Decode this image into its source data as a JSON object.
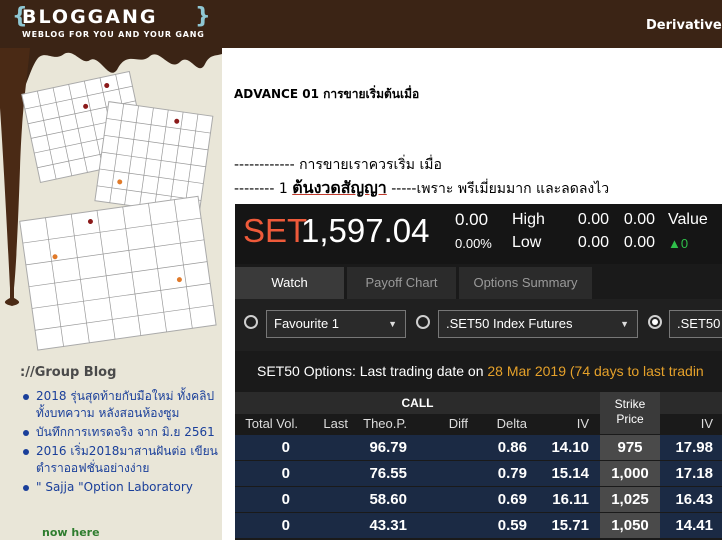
{
  "header": {
    "logo_text": "BLOGGANG",
    "logo_tagline": "WEBLOG FOR YOU AND YOUR GANG",
    "right_title": "Derivatives"
  },
  "sidebar": {
    "group_title": "://Group Blog",
    "items": [
      {
        "label": "2018 รุ่นสุดท้ายกับมือใหม่ ทั้งคลิป ทั้งบทความ หลังสอนห้องซูม"
      },
      {
        "label": "บันทึกการเทรดจริง จาก มิ.ย 2561"
      },
      {
        "label": "2016 เริ่ม2018มาสานฝันต่อ เขียนตำราออฟชั่นอย่างง่าย"
      },
      {
        "label": "\" Sajja \"Option Laboratory"
      }
    ],
    "now_here": "now here"
  },
  "post": {
    "title": "ADVANCE 01 การขายเริ่มต้นเมื่อ",
    "line1": "------------  การขายเราควรเริ่ม เมื่อ",
    "line2_prefix": "-------- 1 ",
    "line2_bold": "ต้นงวดสัญญา",
    "line2_suffix": " -----เพราะ พรีเมี่ยมมาก และลดลงไว"
  },
  "app": {
    "symbol": "SET",
    "price": "1,597.04",
    "change": "0.00",
    "change_pct": "0.00%",
    "high_label": "High",
    "low_label": "Low",
    "high_1": "0.00",
    "high_2": "0.00",
    "low_1": "0.00",
    "low_2": "0.00",
    "value_label": "Value",
    "value": "▲0",
    "tabs": [
      {
        "label": "Watch"
      },
      {
        "label": "Payoff Chart"
      },
      {
        "label": "Options Summary"
      }
    ],
    "filter_1": "Favourite 1",
    "filter_2": ".SET50 Index Futures",
    "filter_3": ".SET50",
    "info_prefix": "SET50 Options: Last trading date on ",
    "info_highlight": "28 Mar 2019 (74 days to last tradin",
    "call_header": "CALL",
    "strike_header_1": "Strike",
    "strike_header_2": "Price",
    "columns": [
      "Total Vol.",
      "Last",
      "Theo.P.",
      "Diff",
      "Delta",
      "IV"
    ],
    "put_column": "IV",
    "rows": [
      {
        "total_vol": "0",
        "last": "",
        "theo": "96.79",
        "diff": "",
        "delta": "0.86",
        "iv": "14.10",
        "strike": "975",
        "put_iv": "17.98"
      },
      {
        "total_vol": "0",
        "last": "",
        "theo": "76.55",
        "diff": "",
        "delta": "0.79",
        "iv": "15.14",
        "strike": "1,000",
        "put_iv": "17.18"
      },
      {
        "total_vol": "0",
        "last": "",
        "theo": "58.60",
        "diff": "",
        "delta": "0.69",
        "iv": "16.11",
        "strike": "1,025",
        "put_iv": "16.43"
      },
      {
        "total_vol": "0",
        "last": "",
        "theo": "43.31",
        "diff": "",
        "delta": "0.59",
        "iv": "15.71",
        "strike": "1,050",
        "put_iv": "14.41"
      }
    ]
  }
}
